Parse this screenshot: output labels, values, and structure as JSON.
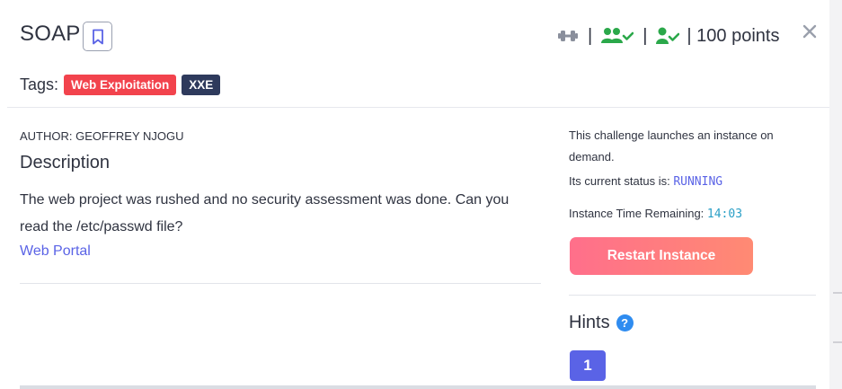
{
  "challenge": {
    "title": "SOAP",
    "points_text": "| 100 points",
    "stat_separator": "|"
  },
  "icons": {
    "bookmark": "bookmark-icon",
    "difficulty": "dumbbell-icon",
    "solvers": "users-check-icon",
    "solved": "user-check-icon",
    "close": "close-icon",
    "hint_help": "question-circle-icon"
  },
  "tags": {
    "label": "Tags:",
    "items": [
      {
        "label": "Web Exploitation",
        "color": "#f2434d"
      },
      {
        "label": "XXE",
        "color": "#2e3a5c"
      }
    ]
  },
  "content": {
    "author": "AUTHOR: GEOFFREY NJOGU",
    "description_heading": "Description",
    "description_text": "The web project was rushed and no security assessment was done. Can you read the /etc/passwd file?",
    "portal_link": "Web Portal"
  },
  "instance": {
    "info": "This challenge launches an instance on demand.",
    "status_label": "Its current status is: ",
    "status_value": "RUNNING",
    "timer_label": "Instance Time Remaining: ",
    "timer_value": "14:03",
    "restart_label": "Restart Instance"
  },
  "hints": {
    "heading": "Hints",
    "help_glyph": "?",
    "items": [
      "1"
    ]
  },
  "colors": {
    "accent": "#5a63e6",
    "success_green": "#2ba84a",
    "button_gradient_start": "#ff6f8b",
    "button_gradient_end": "#ff8a73",
    "help_blue": "#2f8cf0"
  }
}
